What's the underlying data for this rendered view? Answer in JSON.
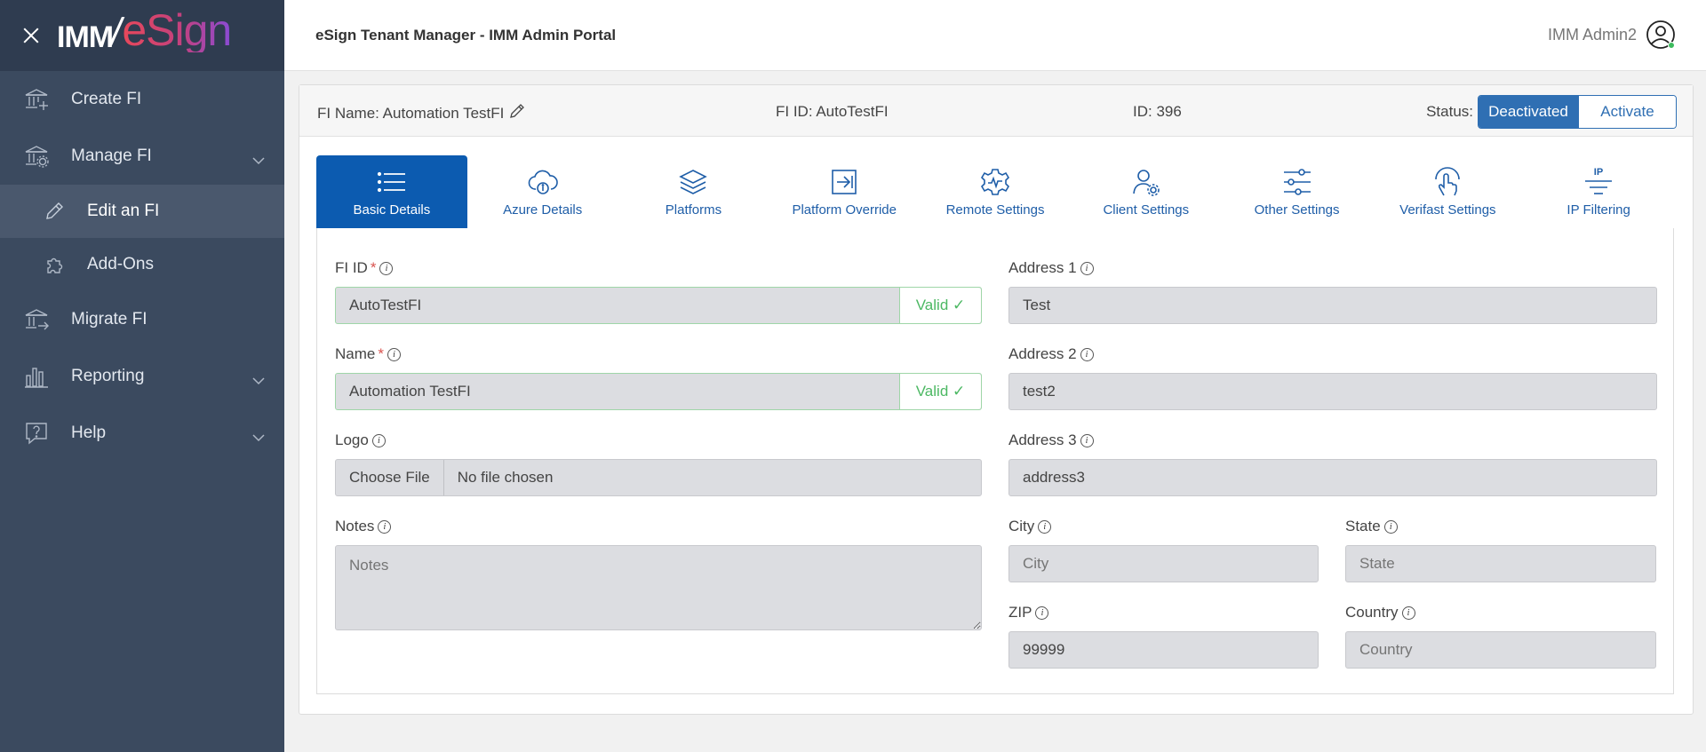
{
  "app": {
    "logo_left": "IMM",
    "logo_slash": "/",
    "logo_right": "eSign",
    "header_title": "eSign Tenant Manager - IMM Admin Portal",
    "user_name": "IMM Admin2"
  },
  "sidebar": {
    "items": [
      {
        "label": "Create FI",
        "icon": "bank-plus-icon"
      },
      {
        "label": "Manage FI",
        "icon": "bank-gear-icon"
      },
      {
        "label": "Edit an FI",
        "icon": "pencil-icon"
      },
      {
        "label": "Add-Ons",
        "icon": "puzzle-icon"
      },
      {
        "label": "Migrate FI",
        "icon": "bank-arrow-icon"
      },
      {
        "label": "Reporting",
        "icon": "bar-chart-icon"
      },
      {
        "label": "Help",
        "icon": "help-bubble-icon"
      }
    ]
  },
  "info_bar": {
    "fi_name": "FI Name: Automation TestFI",
    "fi_id": "FI ID: AutoTestFI",
    "id": "ID: 396",
    "status_label": "Status:",
    "status_on": "Deactivated",
    "status_off": "Activate"
  },
  "tabs": [
    {
      "label": "Basic Details"
    },
    {
      "label": "Azure Details"
    },
    {
      "label": "Platforms"
    },
    {
      "label": "Platform Override"
    },
    {
      "label": "Remote Settings"
    },
    {
      "label": "Client Settings"
    },
    {
      "label": "Other Settings"
    },
    {
      "label": "Verifast Settings"
    },
    {
      "label": "IP Filtering",
      "icon_text": "IP"
    }
  ],
  "form": {
    "fi_id": {
      "label": "FI ID",
      "required": "*",
      "value": "AutoTestFI",
      "valid": "Valid"
    },
    "name": {
      "label": "Name",
      "required": "*",
      "value": "Automation TestFI",
      "valid": "Valid"
    },
    "logo": {
      "label": "Logo",
      "button": "Choose File",
      "value": "No file chosen"
    },
    "notes": {
      "label": "Notes",
      "placeholder": "Notes"
    },
    "address1": {
      "label": "Address 1",
      "value": "Test"
    },
    "address2": {
      "label": "Address 2",
      "value": "test2"
    },
    "address3": {
      "label": "Address 3",
      "value": "address3"
    },
    "city": {
      "label": "City",
      "placeholder": "City"
    },
    "state": {
      "label": "State",
      "placeholder": "State"
    },
    "zip": {
      "label": "ZIP",
      "value": "99999"
    },
    "country": {
      "label": "Country",
      "placeholder": "Country"
    },
    "valid_check": "✓",
    "info_glyph": "i"
  },
  "colors": {
    "sidebar": "#3b4a5f",
    "primary": "#0c5bb0",
    "valid": "#4cb863",
    "required": "#d9534f"
  }
}
